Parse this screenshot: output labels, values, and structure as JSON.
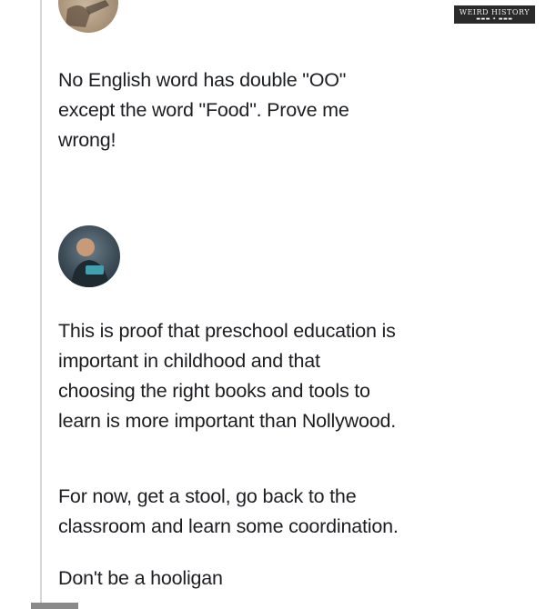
{
  "watermark": {
    "line1": "WEIRD HISTORY",
    "line2": "▬▬▬ ✦ ▬▬▬"
  },
  "post": {
    "text_lines": [
      "No English word has double \"OO\"",
      "except the word \"Food\". Prove me",
      "wrong!"
    ]
  },
  "reply": {
    "paragraph_1_lines": [
      "This is proof that preschool education is",
      "important in childhood and that",
      "choosing the right books and tools to",
      "learn is more important than Nollywood."
    ],
    "paragraph_2_lines": [
      "For now, get a stool, go back to the",
      "classroom and learn some coordination."
    ],
    "paragraph_3": "Don't be a hooligan"
  },
  "avatars": {
    "post_avatar_icon": "profile-photo",
    "reply_avatar_icon": "profile-photo"
  },
  "colors": {
    "text": "#1c1e21",
    "divider": "#d6d6d6",
    "background": "#ffffff"
  }
}
